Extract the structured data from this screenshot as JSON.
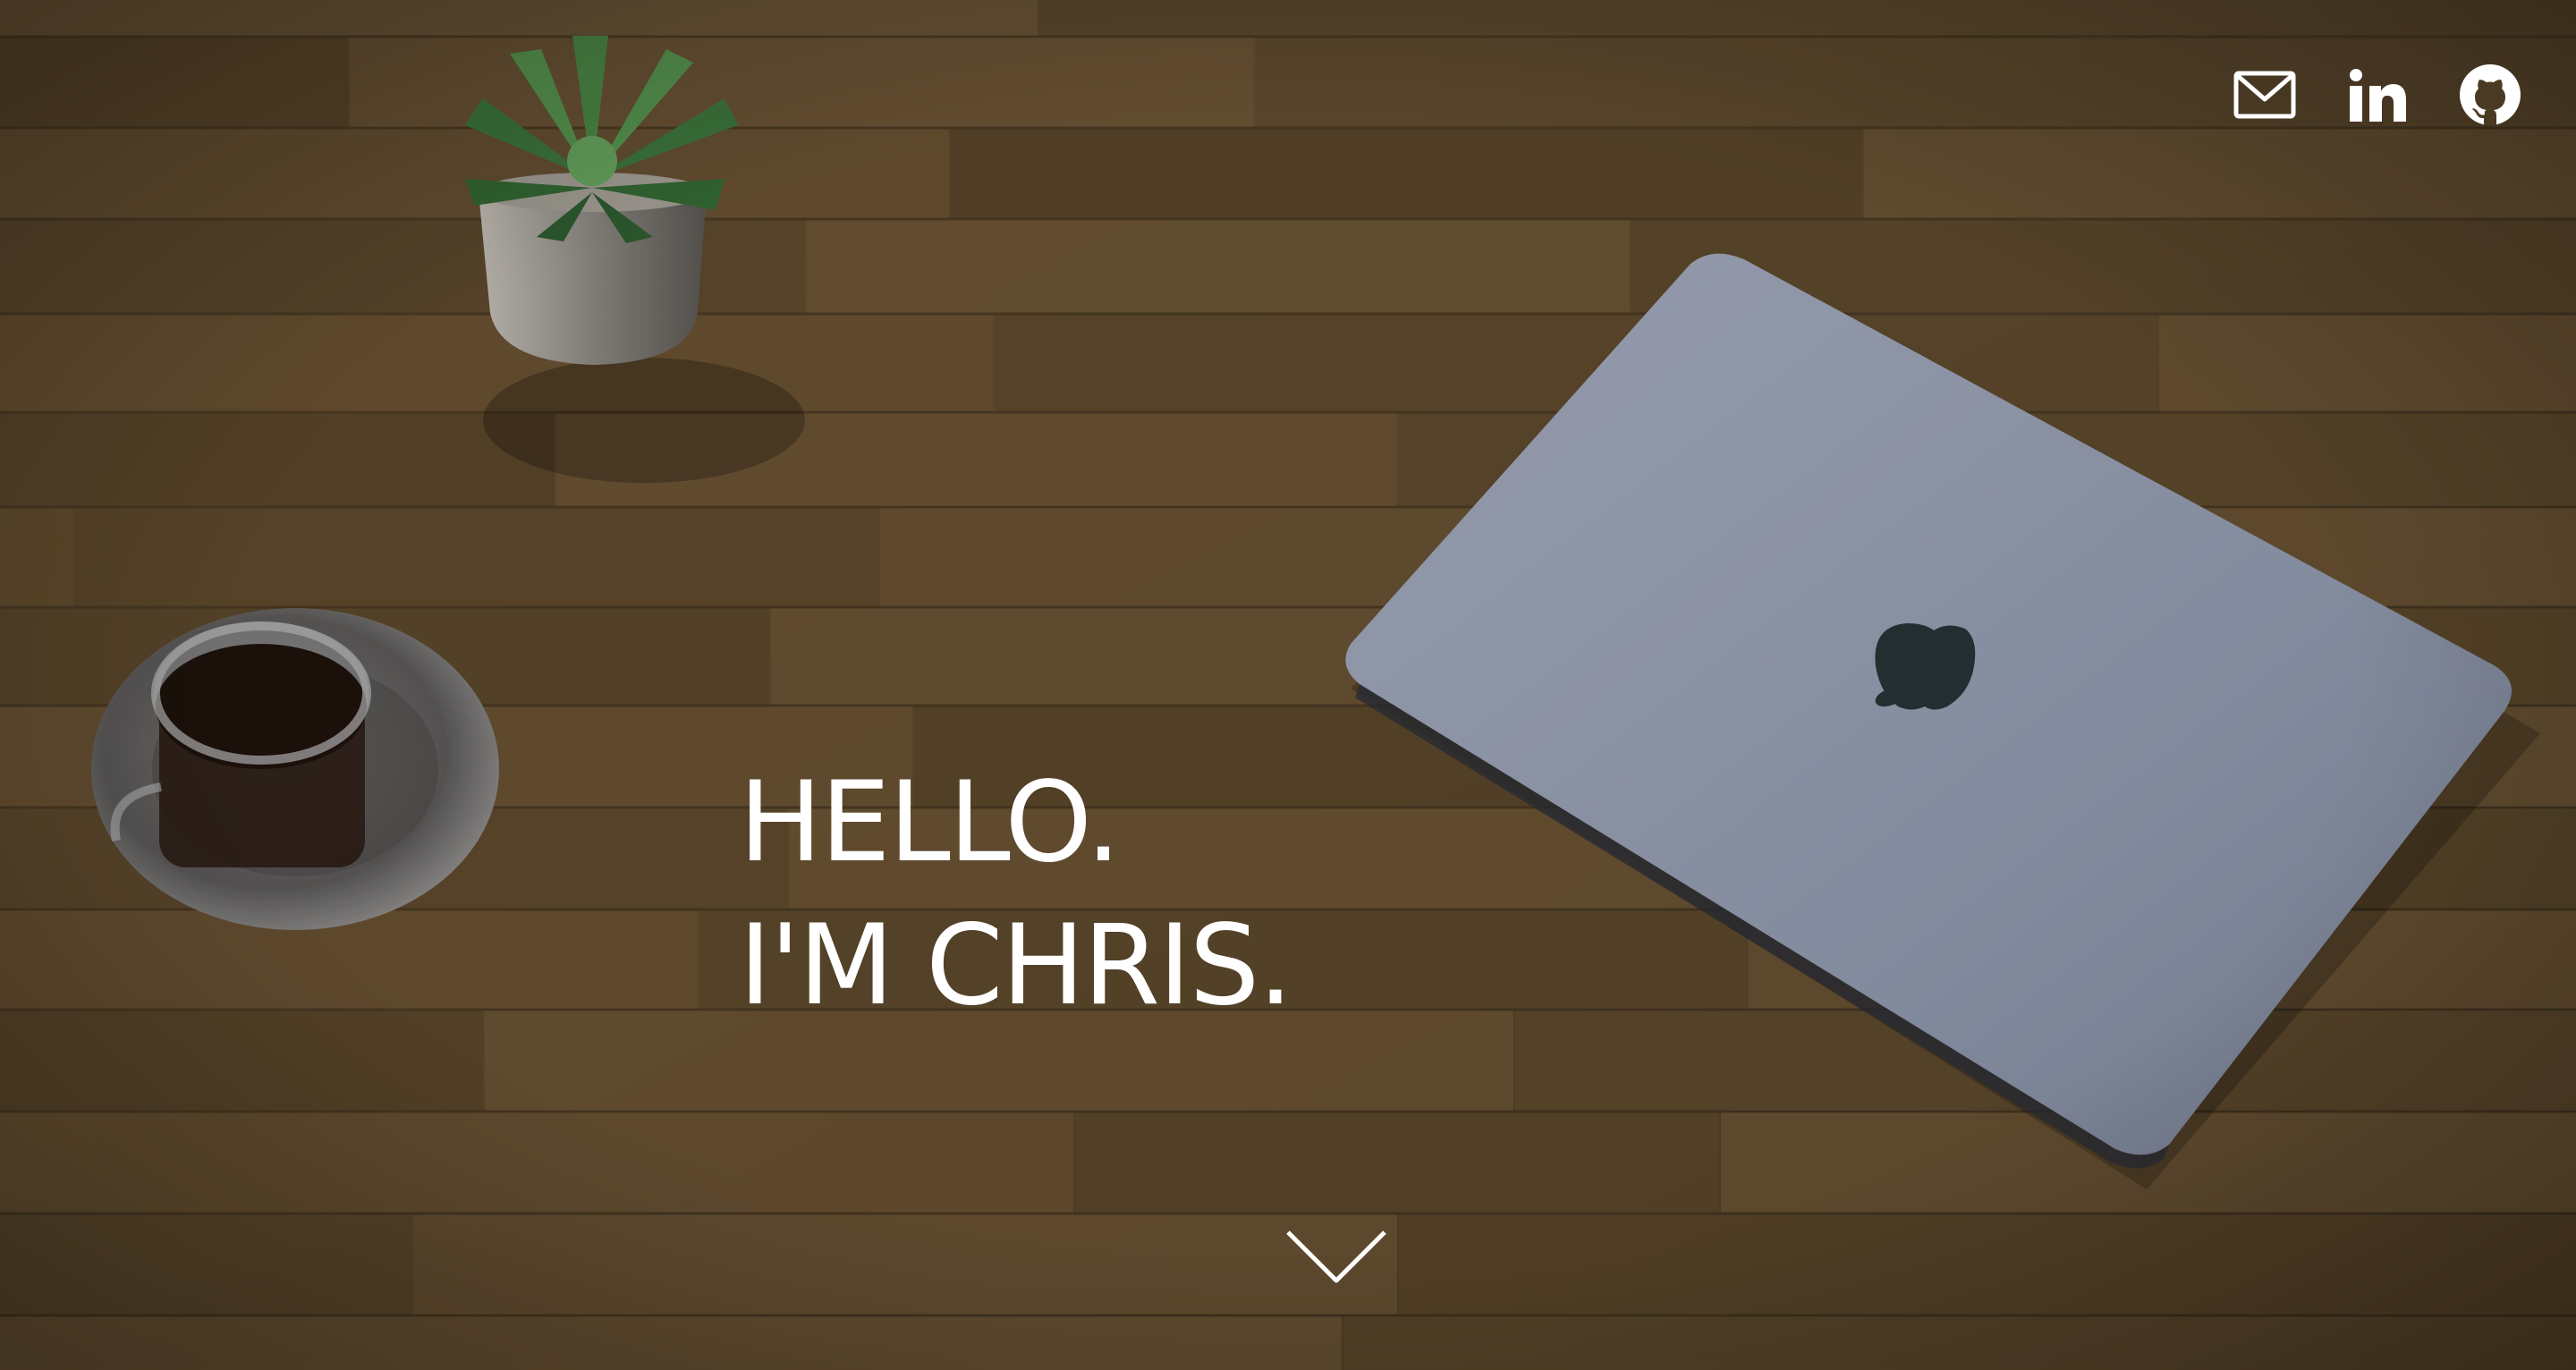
{
  "hero": {
    "headline_line1": "HELLO.",
    "headline_line2": "I'M CHRIS.",
    "background_scene": "wood-desk-with-laptop-plant-coffee"
  },
  "social_links": [
    {
      "name": "email",
      "icon": "envelope-icon"
    },
    {
      "name": "linkedin",
      "icon": "linkedin-icon"
    },
    {
      "name": "github",
      "icon": "github-icon"
    }
  ],
  "scroll_indicator": {
    "icon": "chevron-down-icon"
  },
  "colors": {
    "text": "#ffffff",
    "wood_dark": "#4a3a24",
    "wood_mid": "#6b5434",
    "laptop": "#9aa3b8"
  }
}
